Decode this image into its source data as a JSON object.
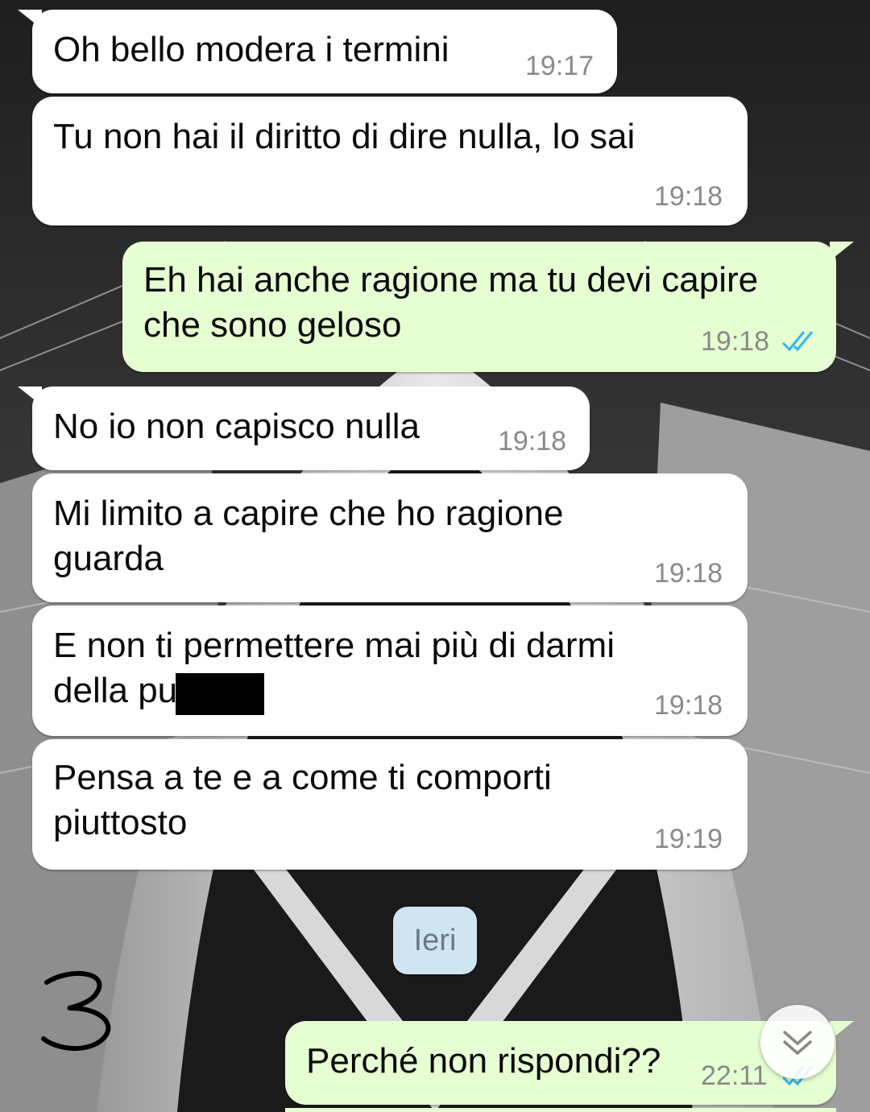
{
  "messages": [
    {
      "direction": "in",
      "text": "Oh bello modera i termini",
      "time": "19:17"
    },
    {
      "direction": "in",
      "text": "Tu non hai il diritto di dire nulla, lo sai",
      "time": "19:18"
    },
    {
      "direction": "out",
      "text": "Eh hai anche ragione ma tu devi capire\nche sono geloso",
      "time": "19:18",
      "status": "read"
    },
    {
      "direction": "in",
      "text": "No io non capisco nulla",
      "time": "19:18"
    },
    {
      "direction": "in",
      "text": "Mi limito a capire che ho ragione\nguarda",
      "time": "19:18"
    },
    {
      "direction": "in",
      "text": "E non ti permettere mai più di darmi\ndella pu      a",
      "time": "19:18"
    },
    {
      "direction": "in",
      "text": "Pensa a te e a come ti comporti\npiuttosto",
      "time": "19:19"
    },
    {
      "direction": "out",
      "text": "Perché non rispondi??",
      "time": "22:11",
      "status": "read"
    }
  ],
  "date_separator": "Ieri",
  "annotation": "3",
  "icons": {
    "read_ticks": "double-check-icon",
    "scroll_down": "chevron-double-down-icon"
  },
  "colors": {
    "incoming_bubble": "#ffffff",
    "outgoing_bubble": "#e6ffd2",
    "read_ticks": "#34b7f1",
    "date_chip": "#cfe5f2"
  }
}
